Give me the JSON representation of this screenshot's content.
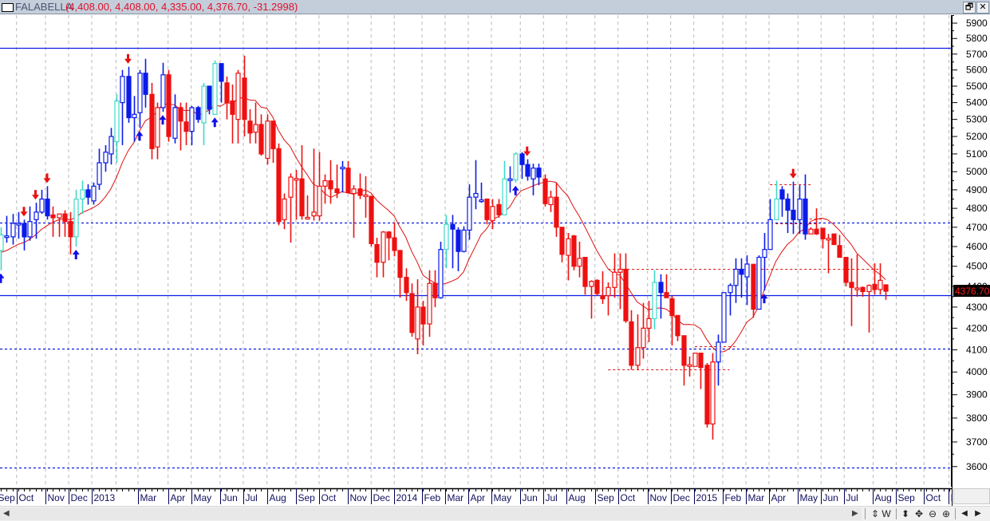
{
  "window": {
    "symbol": "FALABELLA",
    "ohlc_readout": "(4,408.00, 4,408.00, 4,335.00, 4,376.70, -31.2998)",
    "restore_icon": "restore-icon",
    "close_icon": "close-icon",
    "restore_glyph": "🗗",
    "close_glyph": "✕"
  },
  "toolbar": {
    "scroll_left": "◀",
    "scroll_right": "▶",
    "refresh": "⇕",
    "weekly": "W",
    "vscale": "⬍",
    "move": "✥",
    "zoom_out": "⊖",
    "zoom_in": "⊕",
    "prev": "◀",
    "next": "▶"
  },
  "chart_data": {
    "type": "candlestick",
    "title": "FALABELLA",
    "scale": "log",
    "ylim": [
      3565,
      5960
    ],
    "colors": {
      "b": "#0a1be8",
      "r": "#ee1010",
      "c": "#40d8c8",
      "ma": "#e01010",
      "hline": "#0a1be8"
    },
    "last_price_label": "4376.70",
    "last_price": 4376.7,
    "y_ticks": [
      5900,
      5800,
      5700,
      5600,
      5500,
      5400,
      5300,
      5200,
      5100,
      5000,
      4900,
      4800,
      4700,
      4600,
      4500,
      4400,
      4300,
      4200,
      4100,
      4000,
      3900,
      3800,
      3700,
      3600
    ],
    "x_labels": [
      {
        "label": "Sep",
        "i": -0.5
      },
      {
        "label": "Oct",
        "i": 3
      },
      {
        "label": "Nov",
        "i": 8
      },
      {
        "label": "Dec",
        "i": 12
      },
      {
        "label": "2013",
        "i": 16
      },
      {
        "label": "",
        "i": 20.2
      },
      {
        "label": "Mar",
        "i": 24
      },
      {
        "label": "Apr",
        "i": 29.2
      },
      {
        "label": "May",
        "i": 33.2
      },
      {
        "label": "Jun",
        "i": 38.2
      },
      {
        "label": "Jul",
        "i": 42.2
      },
      {
        "label": "Aug",
        "i": 46.3
      },
      {
        "label": "Sep",
        "i": 51.3
      },
      {
        "label": "Oct",
        "i": 55.3
      },
      {
        "label": "Nov",
        "i": 60.3
      },
      {
        "label": "Dec",
        "i": 64.3
      },
      {
        "label": "2014",
        "i": 68.3
      },
      {
        "label": "Feb",
        "i": 73.1
      },
      {
        "label": "Mar",
        "i": 77.1
      },
      {
        "label": "Apr",
        "i": 81.1
      },
      {
        "label": "May",
        "i": 85.1
      },
      {
        "label": "Jun",
        "i": 90.1
      },
      {
        "label": "Jul",
        "i": 94.1
      },
      {
        "label": "Aug",
        "i": 98.1
      },
      {
        "label": "Sep",
        "i": 103
      },
      {
        "label": "Oct",
        "i": 107
      },
      {
        "label": "Nov",
        "i": 112.1
      },
      {
        "label": "Dec",
        "i": 116.1
      },
      {
        "label": "2015",
        "i": 120.1
      },
      {
        "label": "Feb",
        "i": 125.1
      },
      {
        "label": "Mar",
        "i": 129.1
      },
      {
        "label": "Apr",
        "i": 133.1
      },
      {
        "label": "May",
        "i": 138.1
      },
      {
        "label": "Jun",
        "i": 142.1
      },
      {
        "label": "Jul",
        "i": 146.1
      },
      {
        "label": "Aug",
        "i": 151.1
      },
      {
        "label": "Sep",
        "i": 155.1
      },
      {
        "label": "Oct",
        "i": 159.9
      },
      {
        "label": "I",
        "i": 164.2
      }
    ],
    "ma_period": 10,
    "candles": [
      [
        4580,
        4700,
        4480,
        4660,
        "c"
      ],
      [
        4650,
        4760,
        4620,
        4655,
        "b"
      ],
      [
        4650,
        4770,
        4610,
        4720,
        "b"
      ],
      [
        4715,
        4780,
        4640,
        4720,
        "b"
      ],
      [
        4720,
        4740,
        4580,
        4650,
        "b"
      ],
      [
        4650,
        4810,
        4630,
        4730,
        "b"
      ],
      [
        4740,
        4830,
        4640,
        4780,
        "b"
      ],
      [
        4780,
        4900,
        4770,
        4850,
        "b"
      ],
      [
        4850,
        4920,
        4740,
        4760,
        "b"
      ],
      [
        4765,
        4810,
        4650,
        4750,
        "r"
      ],
      [
        4750,
        4770,
        4650,
        4770,
        "r"
      ],
      [
        4770,
        4790,
        4650,
        4730,
        "r"
      ],
      [
        4730,
        4780,
        4560,
        4650,
        "r"
      ],
      [
        4650,
        4900,
        4600,
        4850,
        "c"
      ],
      [
        4850,
        4950,
        4770,
        4900,
        "c"
      ],
      [
        4900,
        4930,
        4820,
        4860,
        "b"
      ],
      [
        4840,
        4940,
        4820,
        4920,
        "b"
      ],
      [
        4930,
        5130,
        4900,
        5050,
        "b"
      ],
      [
        5050,
        5150,
        5000,
        5110,
        "b"
      ],
      [
        5100,
        5250,
        5040,
        5200,
        "b"
      ],
      [
        5170,
        5450,
        5050,
        5410,
        "c"
      ],
      [
        5400,
        5600,
        5150,
        5560,
        "b"
      ],
      [
        5560,
        5620,
        5280,
        5310,
        "b"
      ],
      [
        5310,
        5440,
        5170,
        5330,
        "b"
      ],
      [
        5340,
        5600,
        5250,
        5580,
        "b"
      ],
      [
        5580,
        5670,
        5370,
        5450,
        "b"
      ],
      [
        5450,
        5520,
        5070,
        5130,
        "r"
      ],
      [
        5140,
        5400,
        5070,
        5370,
        "r"
      ],
      [
        5370,
        5645,
        5345,
        5570,
        "b"
      ],
      [
        5570,
        5600,
        5170,
        5200,
        "r"
      ],
      [
        5190,
        5450,
        5160,
        5370,
        "b"
      ],
      [
        5370,
        5400,
        5120,
        5290,
        "r"
      ],
      [
        5285,
        5400,
        5150,
        5230,
        "r"
      ],
      [
        5230,
        5380,
        5150,
        5370,
        "b"
      ],
      [
        5370,
        5380,
        5280,
        5300,
        "b"
      ],
      [
        5280,
        5520,
        5150,
        5500,
        "c"
      ],
      [
        5500,
        5500,
        5330,
        5360,
        "b"
      ],
      [
        5330,
        5660,
        5330,
        5640,
        "c"
      ],
      [
        5640,
        5640,
        5400,
        5530,
        "b"
      ],
      [
        5520,
        5560,
        5300,
        5400,
        "r"
      ],
      [
        5410,
        5510,
        5160,
        5330,
        "r"
      ],
      [
        5300,
        5600,
        5160,
        5580,
        "r"
      ],
      [
        5550,
        5690,
        5200,
        5300,
        "r"
      ],
      [
        5290,
        5360,
        5160,
        5220,
        "r"
      ],
      [
        5225,
        5400,
        5160,
        5270,
        "r"
      ],
      [
        5270,
        5330,
        5090,
        5100,
        "r"
      ],
      [
        5075,
        5330,
        5040,
        5290,
        "r"
      ],
      [
        5290,
        5290,
        5050,
        5130,
        "r"
      ],
      [
        5130,
        5160,
        4710,
        4730,
        "r"
      ],
      [
        4740,
        4880,
        4690,
        4850,
        "r"
      ],
      [
        4860,
        4990,
        4620,
        4970,
        "r"
      ],
      [
        4960,
        5010,
        4740,
        4962,
        "r"
      ],
      [
        4960,
        5150,
        4740,
        4760,
        "r"
      ],
      [
        4750,
        4870,
        4740,
        4752,
        "r"
      ],
      [
        4760,
        5130,
        4735,
        4780,
        "r"
      ],
      [
        4760,
        5110,
        4735,
        4920,
        "r"
      ],
      [
        4920,
        4985,
        4825,
        4950,
        "r"
      ],
      [
        4950,
        5065,
        4825,
        4905,
        "r"
      ],
      [
        4905,
        5040,
        4855,
        4885,
        "r"
      ],
      [
        5020,
        5060,
        4885,
        5025,
        "b"
      ],
      [
        5020,
        5060,
        4885,
        4885,
        "r"
      ],
      [
        4880,
        4925,
        4645,
        4905,
        "r"
      ],
      [
        4905,
        4990,
        4850,
        4870,
        "r"
      ],
      [
        4870,
        4975,
        4750,
        4872,
        "r"
      ],
      [
        4865,
        4865,
        4600,
        4615,
        "r"
      ],
      [
        4610,
        4645,
        4445,
        4520,
        "r"
      ],
      [
        4520,
        4680,
        4445,
        4675,
        "r"
      ],
      [
        4675,
        4680,
        4530,
        4645,
        "r"
      ],
      [
        4645,
        4725,
        4550,
        4580,
        "r"
      ],
      [
        4580,
        4580,
        4345,
        4445,
        "r"
      ],
      [
        4445,
        4490,
        4330,
        4370,
        "r"
      ],
      [
        4365,
        4415,
        4160,
        4180,
        "r"
      ],
      [
        4150,
        4435,
        4080,
        4300,
        "r"
      ],
      [
        4300,
        4330,
        4120,
        4220,
        "r"
      ],
      [
        4220,
        4480,
        4160,
        4415,
        "r"
      ],
      [
        4415,
        4480,
        4300,
        4345,
        "r"
      ],
      [
        4345,
        4625,
        4340,
        4585,
        "b"
      ],
      [
        4585,
        4765,
        4490,
        4715,
        "c"
      ],
      [
        4715,
        4765,
        4490,
        4690,
        "b"
      ],
      [
        4685,
        4700,
        4475,
        4575,
        "b"
      ],
      [
        4575,
        4705,
        4570,
        4685,
        "b"
      ],
      [
        4685,
        4930,
        4635,
        4860,
        "b"
      ],
      [
        4860,
        5065,
        4795,
        4880,
        "b"
      ],
      [
        4840,
        4940,
        4830,
        4845,
        "b"
      ],
      [
        4850,
        4850,
        4715,
        4740,
        "r"
      ],
      [
        4735,
        4850,
        4690,
        4810,
        "r"
      ],
      [
        4820,
        4850,
        4750,
        4765,
        "r"
      ],
      [
        4765,
        5060,
        4765,
        4960,
        "c"
      ],
      [
        4955,
        5030,
        4885,
        4960,
        "b"
      ],
      [
        4955,
        5110,
        4940,
        5100,
        "c"
      ],
      [
        5100,
        5110,
        4960,
        5040,
        "b"
      ],
      [
        5040,
        5070,
        4950,
        4975,
        "b"
      ],
      [
        4960,
        5045,
        4870,
        5020,
        "b"
      ],
      [
        5020,
        5045,
        4925,
        4970,
        "b"
      ],
      [
        4960,
        4985,
        4810,
        4825,
        "r"
      ],
      [
        4820,
        4895,
        4780,
        4860,
        "r"
      ],
      [
        4860,
        4940,
        4650,
        4700,
        "r"
      ],
      [
        4700,
        4700,
        4520,
        4560,
        "r"
      ],
      [
        4555,
        4670,
        4430,
        4640,
        "r"
      ],
      [
        4655,
        4660,
        4480,
        4500,
        "r"
      ],
      [
        4500,
        4625,
        4445,
        4540,
        "r"
      ],
      [
        4545,
        4545,
        4360,
        4400,
        "r"
      ],
      [
        4400,
        4430,
        4245,
        4425,
        "r"
      ],
      [
        4430,
        4435,
        4355,
        4365,
        "r"
      ],
      [
        4355,
        4475,
        4315,
        4340,
        "r"
      ],
      [
        4355,
        4420,
        4260,
        4395,
        "r"
      ],
      [
        4395,
        4565,
        4345,
        4470,
        "r"
      ],
      [
        4470,
        4565,
        4290,
        4485,
        "r"
      ],
      [
        4485,
        4565,
        4225,
        4235,
        "r"
      ],
      [
        4230,
        4285,
        4010,
        4030,
        "r"
      ],
      [
        4030,
        4265,
        4010,
        4110,
        "r"
      ],
      [
        4110,
        4320,
        4060,
        4200,
        "r"
      ],
      [
        4200,
        4330,
        4135,
        4245,
        "r"
      ],
      [
        4245,
        4480,
        4195,
        4420,
        "c"
      ],
      [
        4420,
        4460,
        4245,
        4370,
        "b"
      ],
      [
        4370,
        4460,
        4345,
        4345,
        "r"
      ],
      [
        4340,
        4355,
        4120,
        4260,
        "r"
      ],
      [
        4260,
        4260,
        4140,
        4165,
        "r"
      ],
      [
        4165,
        4165,
        3940,
        4030,
        "r"
      ],
      [
        4030,
        4070,
        3980,
        4032,
        "r"
      ],
      [
        4025,
        4085,
        4025,
        4085,
        "r"
      ],
      [
        4085,
        4085,
        3925,
        4020,
        "r"
      ],
      [
        4030,
        4040,
        3760,
        3775,
        "r"
      ],
      [
        3775,
        4085,
        3710,
        4045,
        "r"
      ],
      [
        4045,
        4170,
        3940,
        4135,
        "b"
      ],
      [
        4135,
        4370,
        4135,
        4370,
        "b"
      ],
      [
        4370,
        4415,
        4260,
        4405,
        "b"
      ],
      [
        4405,
        4540,
        4320,
        4485,
        "b"
      ],
      [
        4485,
        4540,
        4345,
        4460,
        "b"
      ],
      [
        4447,
        4555,
        4310,
        4511,
        "b"
      ],
      [
        4510,
        4510,
        4250,
        4290,
        "r"
      ],
      [
        4290,
        4555,
        4290,
        4545,
        "b"
      ],
      [
        4545,
        4670,
        4380,
        4585,
        "b"
      ],
      [
        4585,
        4850,
        4585,
        4740,
        "b"
      ],
      [
        4740,
        4950,
        4740,
        4850,
        "c"
      ],
      [
        4900,
        4920,
        4755,
        4850,
        "b"
      ],
      [
        4850,
        4880,
        4670,
        4790,
        "b"
      ],
      [
        4790,
        4945,
        4665,
        4740,
        "b"
      ],
      [
        4740,
        4925,
        4665,
        4850,
        "b"
      ],
      [
        4850,
        4985,
        4635,
        4665,
        "b"
      ],
      [
        4665,
        4700,
        4665,
        4690,
        "r"
      ],
      [
        4690,
        4800,
        4660,
        4665,
        "r"
      ],
      [
        4695,
        4695,
        4590,
        4640,
        "r"
      ],
      [
        4640,
        4665,
        4465,
        4642,
        "r"
      ],
      [
        4665,
        4665,
        4610,
        4610,
        "r"
      ],
      [
        4605,
        4660,
        4545,
        4545,
        "r"
      ],
      [
        4545,
        4545,
        4400,
        4420,
        "r"
      ],
      [
        4420,
        4540,
        4210,
        4395,
        "r"
      ],
      [
        4390,
        4560,
        4350,
        4392,
        "r"
      ],
      [
        4395,
        4400,
        4350,
        4375,
        "r"
      ],
      [
        4375,
        4410,
        4180,
        4405,
        "r"
      ],
      [
        4410,
        4515,
        4360,
        4385,
        "r"
      ],
      [
        4385,
        4515,
        4360,
        4430,
        "r"
      ],
      [
        4408,
        4408,
        4335,
        4376.7,
        "r"
      ]
    ],
    "horizontal_lines": [
      {
        "price": 5740,
        "style": "solid"
      },
      {
        "price": 4357,
        "style": "solid"
      },
      {
        "price": 4725,
        "style": "dotted"
      },
      {
        "price": 4105,
        "style": "dotted"
      },
      {
        "price": 3596,
        "style": "dotted"
      }
    ],
    "segment_lines": [
      {
        "price": 4485,
        "from": 105,
        "to": 152
      },
      {
        "price": 4010,
        "from": 105,
        "to": 126
      },
      {
        "price": 4115,
        "from": 120,
        "to": 127
      },
      {
        "price": 4930,
        "from": 133,
        "to": 140
      },
      {
        "price": 4720,
        "from": 134,
        "to": 141
      },
      {
        "price": 4745,
        "from": 139,
        "to": 143
      }
    ],
    "down_arrows": [
      4,
      6,
      8,
      22,
      91,
      137
    ],
    "up_arrows": [
      0,
      13,
      24,
      28,
      37,
      89,
      132
    ]
  }
}
